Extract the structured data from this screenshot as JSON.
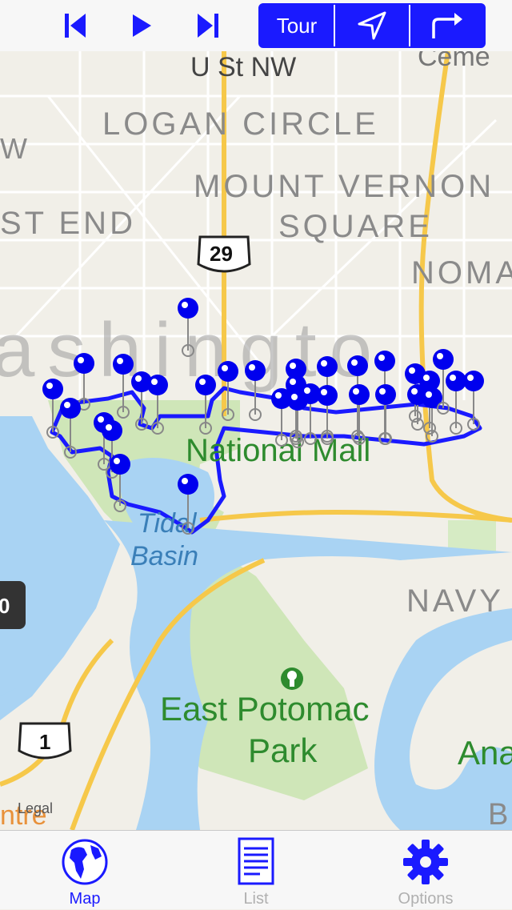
{
  "toolbar": {
    "prev_icon": "skip-previous-icon",
    "play_icon": "play-icon",
    "next_icon": "skip-next-icon",
    "segments": [
      {
        "label": "Tour"
      },
      {
        "label": "",
        "icon": "navigation-arrow-icon"
      },
      {
        "label": "",
        "icon": "turn-right-arrow-icon"
      }
    ],
    "accent_color": "#1a1aff"
  },
  "map": {
    "labels": {
      "u_st": "U St NW",
      "cemetery": "Ceme",
      "logan": "LOGAN CIRCLE",
      "w": "W",
      "mount_vernon_1": "MOUNT VERNON",
      "mount_vernon_2": "SQUARE",
      "west_end": "ST END",
      "noma": "NOMA",
      "washington": "ashingto",
      "national_mall": "National Mall",
      "tidal_1": "Tidal",
      "tidal_2": "Basin",
      "navy": "NAVY",
      "east_potomac_1": "East Potomac",
      "east_potomac_2": "Park",
      "ana": "Ana",
      "centre": "ntre",
      "b": "B",
      "route_29": "29",
      "route_1": "1",
      "route_0": "0"
    },
    "route_color": "#1a1aff",
    "pin_color": "#0000ee"
  },
  "legal": "Legal",
  "tabs": [
    {
      "label": "Map",
      "icon": "globe-icon",
      "active": true
    },
    {
      "label": "List",
      "icon": "document-list-icon",
      "active": false
    },
    {
      "label": "Options",
      "icon": "gear-icon",
      "active": false
    }
  ]
}
